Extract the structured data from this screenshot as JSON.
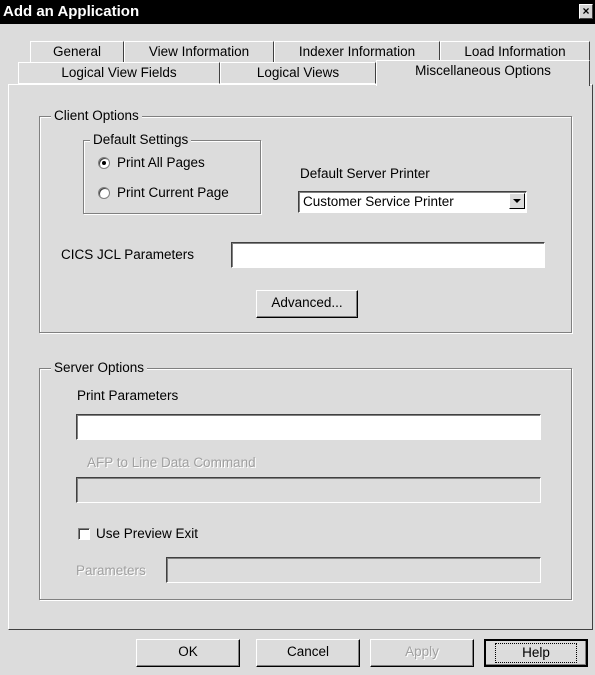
{
  "window": {
    "title": "Add an Application",
    "close_glyph": "×"
  },
  "tabs_row1": [
    {
      "label": "General"
    },
    {
      "label": "View Information"
    },
    {
      "label": "Indexer Information"
    },
    {
      "label": "Load Information"
    }
  ],
  "tabs_row2": [
    {
      "label": "Logical View Fields"
    },
    {
      "label": "Logical Views"
    },
    {
      "label": "Miscellaneous Options",
      "active": true
    }
  ],
  "client_options": {
    "legend": "Client Options",
    "default_settings": {
      "legend": "Default Settings",
      "options": [
        {
          "label": "Print All Pages",
          "selected": true
        },
        {
          "label": "Print Current Page",
          "selected": false
        }
      ]
    },
    "default_server_printer": {
      "label": "Default Server Printer",
      "value": "Customer Service Printer"
    },
    "cics_jcl": {
      "label": "CICS JCL Parameters",
      "value": ""
    },
    "advanced_button": "Advanced..."
  },
  "server_options": {
    "legend": "Server Options",
    "print_parameters": {
      "label": "Print Parameters",
      "value": ""
    },
    "afp_command": {
      "label": "AFP to Line Data Command",
      "value": "",
      "enabled": false
    },
    "use_preview_exit": {
      "label": "Use Preview Exit",
      "checked": false
    },
    "parameters": {
      "label": "Parameters",
      "value": "",
      "enabled": false
    }
  },
  "buttons": {
    "ok": "OK",
    "cancel": "Cancel",
    "apply": "Apply",
    "help": "Help"
  }
}
